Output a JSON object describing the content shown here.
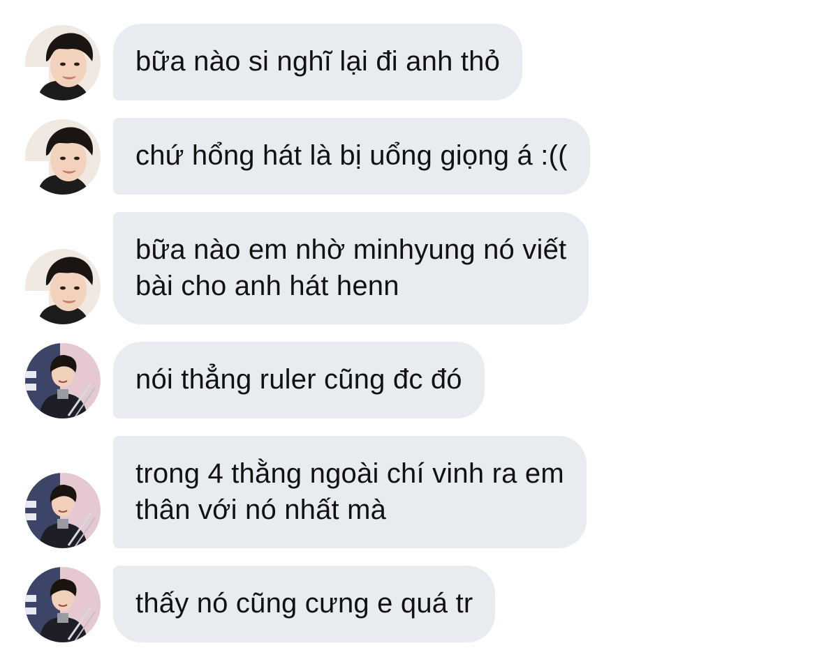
{
  "messages": [
    {
      "sender": "A",
      "lines": [
        "bữa nào si nghĩ lại đi anh thỏ"
      ]
    },
    {
      "sender": "A",
      "lines": [
        "chứ hổng hát là bị uổng giọng á :(("
      ]
    },
    {
      "sender": "A",
      "lines": [
        "bữa nào em nhờ minhyung nó viết",
        "bài cho anh hát henn"
      ]
    },
    {
      "sender": "B",
      "lines": [
        "nói thẳng ruler cũng đc đó"
      ]
    },
    {
      "sender": "B",
      "lines": [
        "trong 4 thằng ngoài chí vinh ra em",
        "thân với nó nhất mà"
      ]
    },
    {
      "sender": "B",
      "lines": [
        "thấy nó cũng cưng e quá tr"
      ]
    }
  ],
  "colors": {
    "bubble_bg": "#e8ebf0",
    "text": "#111111",
    "background": "#ffffff"
  },
  "icons": {
    "sender_a": "avatar-photo-young-man",
    "sender_b": "avatar-photo-man-with-trophy"
  }
}
